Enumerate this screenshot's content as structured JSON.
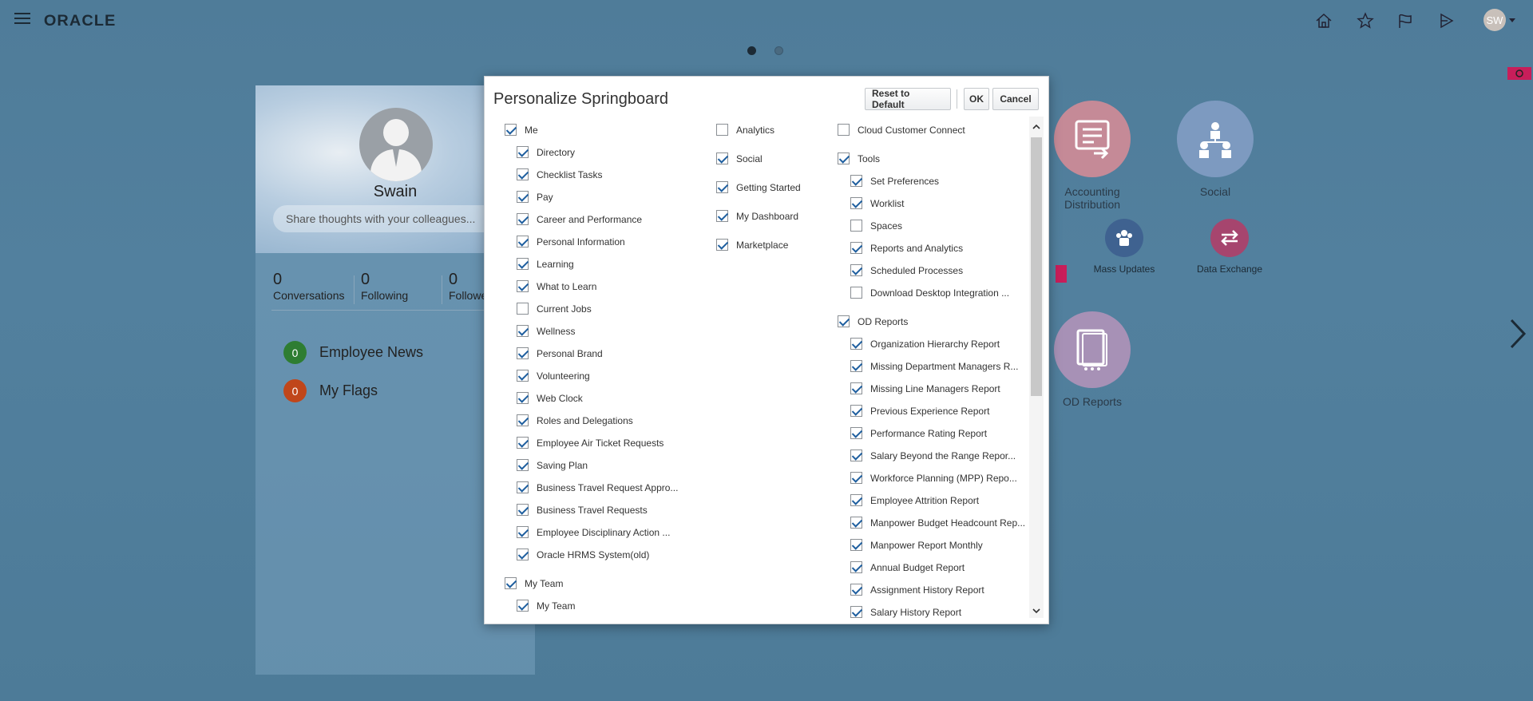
{
  "header": {
    "logo": "ORACLE",
    "avatar_initials": "SW"
  },
  "profile": {
    "name": "Swain",
    "share_placeholder": "Share thoughts with your colleagues...",
    "stats": [
      {
        "num": "0",
        "label": "Conversations"
      },
      {
        "num": "0",
        "label": "Following"
      },
      {
        "num": "0",
        "label": "Followe"
      }
    ],
    "news": [
      {
        "count": "0",
        "label": "Employee News",
        "color": "#2e7d32"
      },
      {
        "count": "0",
        "label": "My Flags",
        "color": "#c0461a"
      }
    ]
  },
  "springboard": {
    "tiles": [
      {
        "label": "Accounting Distribution",
        "label_line1": "Accounting",
        "label_line2": "Distribution",
        "color": "#c58a97"
      },
      {
        "label": "Social",
        "color": "#7d9ac0"
      },
      {
        "label": "OD Reports",
        "color": "#a791b6"
      }
    ],
    "small_tiles": [
      {
        "label": "Mass Updates",
        "color": "#3f6290"
      },
      {
        "label": "Data Exchange",
        "color": "#a6456e"
      }
    ]
  },
  "dialog": {
    "title": "Personalize Springboard",
    "buttons": {
      "reset": "Reset to Default",
      "ok": "OK",
      "cancel": "Cancel"
    },
    "col1": [
      {
        "label": "Me",
        "checked": true,
        "level": 0
      },
      {
        "label": "Directory",
        "checked": true,
        "level": 1
      },
      {
        "label": "Checklist Tasks",
        "checked": true,
        "level": 1
      },
      {
        "label": "Pay",
        "checked": true,
        "level": 1
      },
      {
        "label": "Career and Performance",
        "checked": true,
        "level": 1
      },
      {
        "label": "Personal Information",
        "checked": true,
        "level": 1
      },
      {
        "label": "Learning",
        "checked": true,
        "level": 1
      },
      {
        "label": "What to Learn",
        "checked": true,
        "level": 1
      },
      {
        "label": "Current Jobs",
        "checked": false,
        "level": 1
      },
      {
        "label": "Wellness",
        "checked": true,
        "level": 1
      },
      {
        "label": "Personal Brand",
        "checked": true,
        "level": 1
      },
      {
        "label": "Volunteering",
        "checked": true,
        "level": 1
      },
      {
        "label": "Web Clock",
        "checked": true,
        "level": 1
      },
      {
        "label": "Roles and Delegations",
        "checked": true,
        "level": 1
      },
      {
        "label": "Employee Air Ticket Requests",
        "checked": true,
        "level": 1
      },
      {
        "label": "Saving Plan",
        "checked": true,
        "level": 1
      },
      {
        "label": "Business Travel Request Appro...",
        "checked": true,
        "level": 1
      },
      {
        "label": "Business Travel Requests",
        "checked": true,
        "level": 1
      },
      {
        "label": "Employee Disciplinary Action ...",
        "checked": true,
        "level": 1
      },
      {
        "label": "Oracle HRMS System(old)",
        "checked": true,
        "level": 1
      },
      {
        "label": "My Team",
        "checked": true,
        "level": 0
      },
      {
        "label": "My Team",
        "checked": true,
        "level": 1
      }
    ],
    "col2": [
      {
        "label": "Analytics",
        "checked": false
      },
      {
        "label": "Social",
        "checked": true
      },
      {
        "label": "Getting Started",
        "checked": true
      },
      {
        "label": "My Dashboard",
        "checked": true
      },
      {
        "label": "Marketplace",
        "checked": true
      }
    ],
    "col3": [
      {
        "label": "Cloud Customer Connect",
        "checked": false,
        "level": 0
      },
      {
        "label": "Tools",
        "checked": true,
        "level": 0
      },
      {
        "label": "Set Preferences",
        "checked": true,
        "level": 1
      },
      {
        "label": "Worklist",
        "checked": true,
        "level": 1
      },
      {
        "label": "Spaces",
        "checked": false,
        "level": 1
      },
      {
        "label": "Reports and Analytics",
        "checked": true,
        "level": 1
      },
      {
        "label": "Scheduled Processes",
        "checked": true,
        "level": 1
      },
      {
        "label": "Download Desktop Integration ...",
        "checked": false,
        "level": 1
      },
      {
        "label": "OD Reports",
        "checked": true,
        "level": 0
      },
      {
        "label": "Organization Hierarchy Report",
        "checked": true,
        "level": 1
      },
      {
        "label": "Missing Department Managers R...",
        "checked": true,
        "level": 1
      },
      {
        "label": "Missing Line Managers Report",
        "checked": true,
        "level": 1
      },
      {
        "label": "Previous Experience Report",
        "checked": true,
        "level": 1
      },
      {
        "label": "Performance Rating Report",
        "checked": true,
        "level": 1
      },
      {
        "label": "Salary Beyond the Range Repor...",
        "checked": true,
        "level": 1
      },
      {
        "label": "Workforce Planning (MPP) Repo...",
        "checked": true,
        "level": 1
      },
      {
        "label": "Employee Attrition Report",
        "checked": true,
        "level": 1
      },
      {
        "label": "Manpower Budget Headcount Rep...",
        "checked": true,
        "level": 1
      },
      {
        "label": "Manpower Report Monthly",
        "checked": true,
        "level": 1
      },
      {
        "label": "Annual Budget Report",
        "checked": true,
        "level": 1
      },
      {
        "label": "Assignment History Report",
        "checked": true,
        "level": 1
      },
      {
        "label": "Salary History Report",
        "checked": true,
        "level": 1
      }
    ]
  }
}
